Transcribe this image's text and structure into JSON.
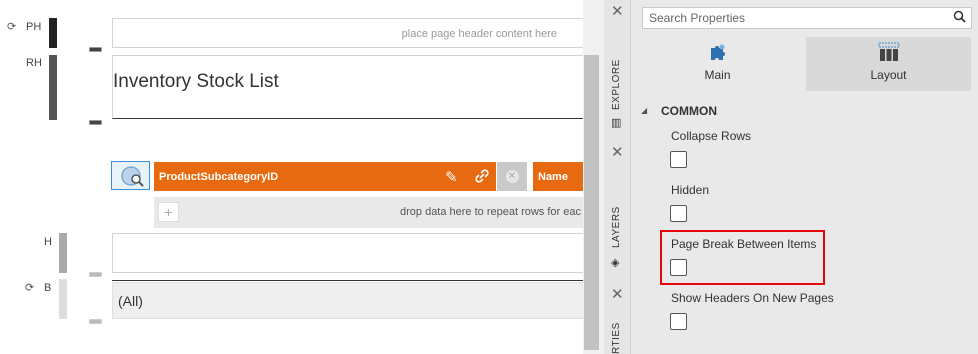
{
  "designer": {
    "bands": {
      "ph": "PH",
      "rh": "RH",
      "h": "H",
      "b": "B"
    },
    "page_header_placeholder": "place page header content here",
    "report_title": "Inventory Stock List",
    "field_primary": "ProductSubcategoryID",
    "field_secondary": "Name",
    "drop_hint": "drop data here to repeat rows for eac",
    "body_value": "(All)"
  },
  "tabstrip": {
    "tabs": [
      {
        "label": "EXPLORE"
      },
      {
        "label": "LAYERS"
      },
      {
        "label": "RTIES"
      }
    ],
    "close_glyph": "✕"
  },
  "properties": {
    "search": {
      "placeholder": "Search Properties",
      "value": ""
    },
    "tabs": {
      "main": "Main",
      "layout": "Layout",
      "active": "Layout"
    },
    "section": {
      "label": "COMMON",
      "expanded": true
    },
    "items": [
      {
        "label": "Collapse Rows",
        "checked": false
      },
      {
        "label": "Hidden",
        "checked": false
      },
      {
        "label": "Page Break Between Items",
        "checked": false,
        "highlighted": true
      },
      {
        "label": "Show Headers On New Pages",
        "checked": false
      }
    ]
  },
  "colors": {
    "field_orange": "#e86a10",
    "highlight_red": "#e3050c",
    "selection_blue": "#3b8fd6",
    "panel_bg": "#e9e9e9"
  },
  "icons": {
    "sync": "sync-icon",
    "search": "search-icon",
    "pencil": "pencil-icon",
    "link": "link-icon",
    "clear": "clear-icon",
    "plus": "plus-icon",
    "main_tab": "puzzle-icon",
    "layout_tab": "layout-grid-icon"
  }
}
